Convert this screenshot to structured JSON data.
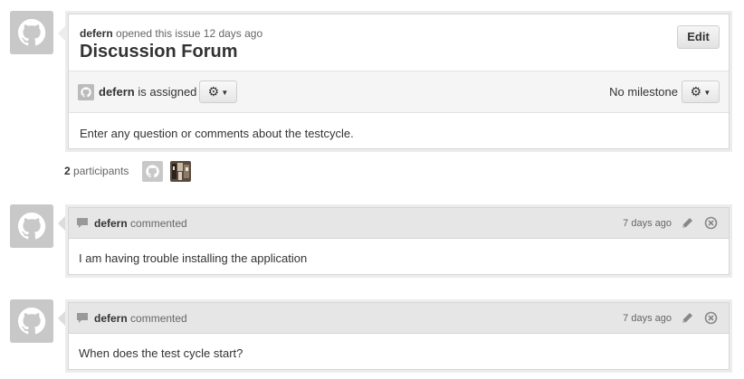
{
  "issue": {
    "author": "defern",
    "opened_text": "opened this issue 12 days ago",
    "title": "Discussion Forum",
    "edit_label": "Edit",
    "assignee": "defern",
    "assigned_text": "is assigned",
    "milestone": "No milestone",
    "body": "Enter any question or comments about the testcycle."
  },
  "participants": {
    "count": "2",
    "label": "participants"
  },
  "comments": [
    {
      "author": "defern",
      "action": "commented",
      "time": "7 days ago",
      "body": "I am having trouble installing the application"
    },
    {
      "author": "defern",
      "action": "commented",
      "time": "7 days ago",
      "body": "When does the test cycle start?"
    }
  ],
  "icons": {
    "avatar": "octocat-identicon",
    "gear": "gear-icon",
    "comment": "speech-bubble-icon",
    "edit": "pencil-icon",
    "delete": "circle-x-icon"
  },
  "colors": {
    "avatar_bg": "#c8c8c8",
    "header_bg": "#e6e6e6",
    "border": "#d6d6d6"
  }
}
